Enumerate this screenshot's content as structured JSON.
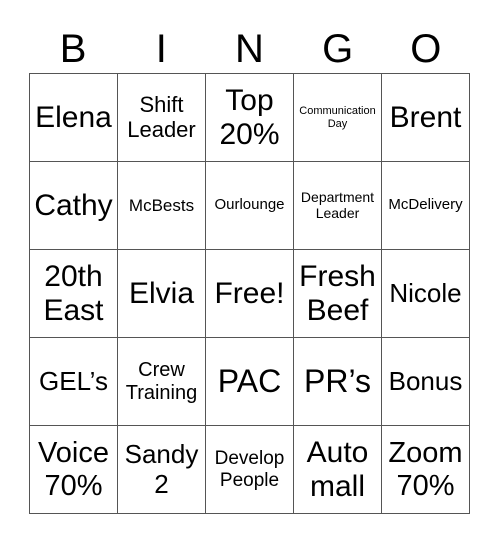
{
  "header": {
    "letters": [
      "B",
      "I",
      "N",
      "G",
      "O"
    ]
  },
  "cells": [
    [
      "Elena",
      "Shift\nLeader",
      "Top\n20%",
      "Communication\nDay",
      "Brent"
    ],
    [
      "Cathy",
      "McBests",
      "Ourlounge",
      "Department\nLeader",
      "McDelivery"
    ],
    [
      "20th\nEast",
      "Elvia",
      "Free!",
      "Fresh\nBeef",
      "Nicole"
    ],
    [
      "GEL’s",
      "Crew\nTraining",
      "PAC",
      "PR’s",
      "Bonus"
    ],
    [
      "Voice\n70%",
      "Sandy\n2",
      "Develop\nPeople",
      "Auto\nmall",
      "Zoom\n70%"
    ]
  ]
}
